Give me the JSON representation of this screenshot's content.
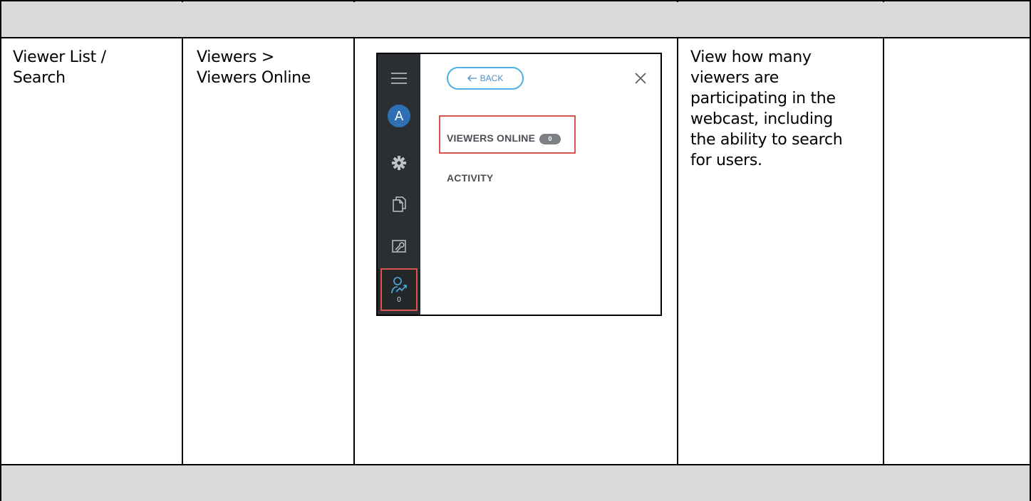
{
  "row": {
    "feature": "Viewer List /\nSearch",
    "location": "Viewers >\nViewers Online",
    "description": "View how many\nviewers are\nparticipating in the\nwebcast, including\nthe ability to search\nfor users.",
    "notes": ""
  },
  "screenshot": {
    "back_label": "BACK",
    "viewers_online_label": "VIEWERS ONLINE",
    "viewers_online_count": "0",
    "activity_label": "ACTIVITY",
    "avatar_initial": "A",
    "viewer_rail_count": "0"
  },
  "colors": {
    "gray_band": "#d9d9d9",
    "highlight": "#d9534f",
    "accent": "#4db0e4",
    "rail": "#2b2f33"
  },
  "icons": [
    "menu-icon",
    "gear-icon",
    "documents-icon",
    "presenter-tools-icon",
    "viewers-icon",
    "close-icon",
    "back-arrow-icon"
  ]
}
